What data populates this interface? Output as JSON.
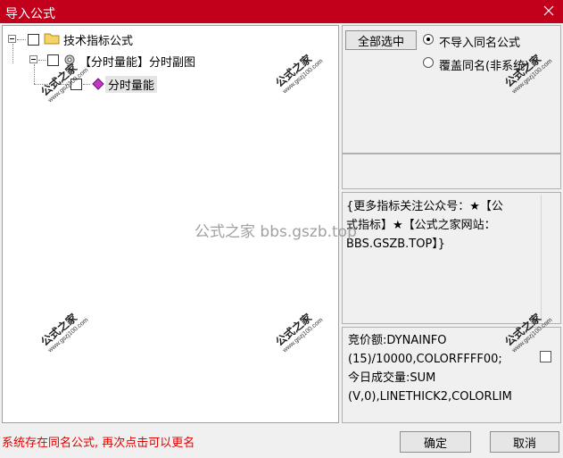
{
  "window": {
    "title": "导入公式"
  },
  "tree": {
    "root_label": "技术指标公式",
    "group_label": "【分时量能】分时副图",
    "item_label": "分时量能"
  },
  "options": {
    "select_all_label": "全部选中",
    "radio_no_import": "不导入同名公式",
    "radio_overwrite": "覆盖同名(非系统)"
  },
  "description": {
    "lines": [
      "{更多指标关注公众号：★【公",
      "式指标】★【公式之家网站：",
      "BBS.GSZB.TOP】}"
    ]
  },
  "code": {
    "lines": [
      "竞价额:DYNAINFO",
      "(15)/10000,COLORFFFF00;",
      "今日成交量:SUM",
      "(V,0),LINETHICK2,COLORLIM"
    ]
  },
  "status": {
    "message": "系统存在同名公式, 再次点击可以更名"
  },
  "buttons": {
    "ok_label": "确定",
    "cancel_label": "取消"
  },
  "watermarks": {
    "center_text": "公式之家 bbs.gszb.top",
    "stamp_big": "公式之家",
    "stamp_small": "www.gszj100.com"
  },
  "colors": {
    "titlebar": "#c3001b",
    "status_text": "#e00000"
  }
}
